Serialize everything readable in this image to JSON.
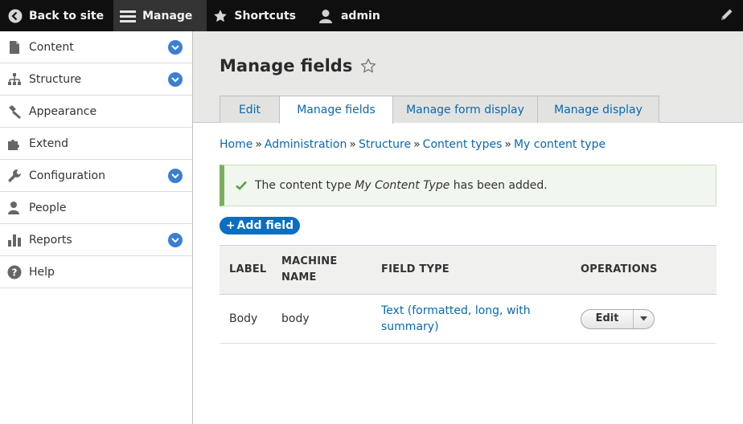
{
  "toolbar": {
    "back_label": "Back to site",
    "manage_label": "Manage",
    "shortcuts_label": "Shortcuts",
    "user_label": "admin",
    "icons": [
      "back-circle-icon",
      "hamburger-icon",
      "star-icon",
      "user-icon",
      "pencil-icon"
    ]
  },
  "sidebar": {
    "items": [
      {
        "label": "Content",
        "icon": "content-icon",
        "expandable": true
      },
      {
        "label": "Structure",
        "icon": "structure-icon",
        "expandable": true
      },
      {
        "label": "Appearance",
        "icon": "appearance-icon",
        "expandable": false
      },
      {
        "label": "Extend",
        "icon": "extend-icon",
        "expandable": false
      },
      {
        "label": "Configuration",
        "icon": "wrench-icon",
        "expandable": true
      },
      {
        "label": "People",
        "icon": "people-icon",
        "expandable": false
      },
      {
        "label": "Reports",
        "icon": "reports-icon",
        "expandable": true
      },
      {
        "label": "Help",
        "icon": "help-icon",
        "expandable": false
      }
    ]
  },
  "page": {
    "title": "Manage fields"
  },
  "tabs": [
    {
      "label": "Edit",
      "active": false
    },
    {
      "label": "Manage fields",
      "active": true
    },
    {
      "label": "Manage form display",
      "active": false
    },
    {
      "label": "Manage display",
      "active": false
    }
  ],
  "breadcrumb": {
    "items": [
      "Home",
      "Administration",
      "Structure",
      "Content types",
      "My content type"
    ],
    "separator": "»"
  },
  "message": {
    "prefix": "The content type ",
    "emphasis": "My Content Type",
    "suffix": " has been added."
  },
  "add_field": {
    "label": "Add field",
    "plus": "+"
  },
  "table": {
    "headers": {
      "label": "LABEL",
      "machine_line1": "MACHINE",
      "machine_line2": "NAME",
      "field_type": "FIELD TYPE",
      "operations": "OPERATIONS"
    },
    "rows": [
      {
        "label": "Body",
        "machine_name": "body",
        "field_type_line1": "Text (formatted, long, with",
        "field_type_line2": "summary)",
        "operation": "Edit"
      }
    ]
  },
  "colors": {
    "toolbar_bg": "#0f0f0f",
    "link": "#0a68b0",
    "primary_button": "#0a6ec2",
    "success_border": "#77b259",
    "chevron_bg": "#3a7fd3"
  }
}
